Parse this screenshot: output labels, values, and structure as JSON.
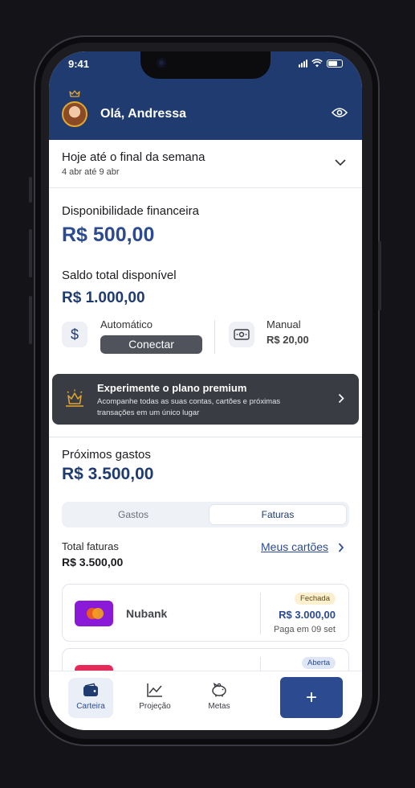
{
  "status_bar": {
    "time": "9:41"
  },
  "header": {
    "greeting": "Olá, Andressa",
    "icons": [
      "crown-icon",
      "eye-icon"
    ]
  },
  "period": {
    "title": "Hoje até o final da semana",
    "range": "4 abr até 9 abr"
  },
  "financial": {
    "availability_label": "Disponibilidade financeira",
    "availability_value": "R$ 500,00",
    "balance_label": "Saldo total disponível",
    "balance_value": "R$ 1.000,00"
  },
  "accounts": {
    "automatic_label": "Automático",
    "connect_label": "Conectar",
    "manual_label": "Manual",
    "manual_value": "R$ 20,00"
  },
  "premium": {
    "title": "Experimente o plano premium",
    "text": "Acompanhe todas as suas contas, cartões e próximas transações em um único lugar"
  },
  "upcoming": {
    "title": "Próximos gastos",
    "value": "R$ 3.500,00",
    "tabs": [
      {
        "label": "Gastos",
        "active": false
      },
      {
        "label": "Faturas",
        "active": true
      }
    ],
    "total_label": "Total faturas",
    "total_value": "R$ 3.500,00",
    "cards_link": "Meus cartões"
  },
  "cards": [
    {
      "name": "Nubank",
      "status": "Fechada",
      "amount": "R$ 3.000,00",
      "due": "Paga em 09 set"
    },
    {
      "status": "Aberta"
    }
  ],
  "bottom_nav": {
    "items": [
      {
        "label": "Carteira",
        "icon": "wallet-icon",
        "active": true
      },
      {
        "label": "Projeção",
        "icon": "chart-icon",
        "active": false
      },
      {
        "label": "Metas",
        "icon": "piggy-bank-icon",
        "active": false
      }
    ],
    "fab_label": "+"
  },
  "colors": {
    "primary": "#1f3b70",
    "accent": "#2c4a90",
    "premium_bg": "#393c42",
    "crown": "#e3a72f"
  }
}
